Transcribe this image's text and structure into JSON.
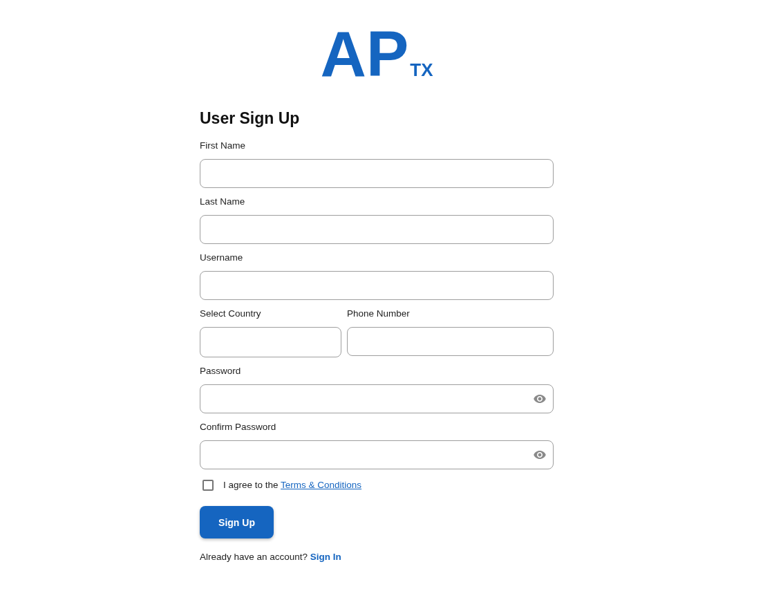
{
  "logo": {
    "letters": "AP",
    "suffix": "TX"
  },
  "title": "User Sign Up",
  "rows": [
    {
      "fields": [
        {
          "label": "First Name",
          "kind": "text"
        }
      ]
    },
    {
      "fields": [
        {
          "label": "Last Name",
          "kind": "text"
        }
      ]
    },
    {
      "fields": [
        {
          "label": "Username",
          "kind": "text"
        }
      ]
    },
    {
      "fields": [
        {
          "label": "Select Country",
          "kind": "select"
        },
        {
          "label": "Phone Number",
          "kind": "text"
        }
      ]
    },
    {
      "fields": [
        {
          "label": "Password",
          "kind": "password"
        }
      ]
    },
    {
      "fields": [
        {
          "label": "Confirm Password",
          "kind": "password"
        }
      ]
    }
  ],
  "agreement": {
    "text": "I agree to the",
    "link": "Terms & Conditions",
    "checked": false
  },
  "submit": {
    "label": "Sign Up"
  },
  "footer": {
    "text": "Already have an account?",
    "link": "Sign In"
  }
}
